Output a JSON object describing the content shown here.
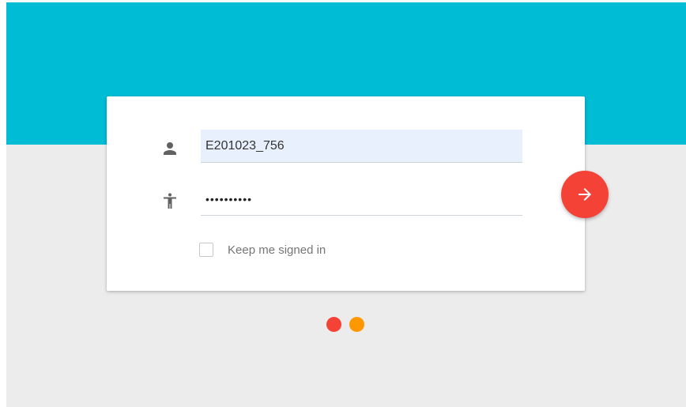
{
  "colors": {
    "accent": "#00bcd4",
    "background": "#ececec",
    "card": "#ffffff",
    "fab": "#f44336",
    "autofill": "#e8f0fe"
  },
  "login": {
    "username": {
      "icon": "person-icon",
      "value": "E201023_756"
    },
    "password": {
      "icon": "accessibility-icon",
      "value": "••••••••••"
    },
    "remember": {
      "label": "Keep me signed in",
      "checked": false
    },
    "submit": {
      "icon": "arrow-right-icon"
    }
  },
  "loader": {
    "dots": [
      {
        "color": "#f44336"
      },
      {
        "color": "#ff9800"
      }
    ]
  }
}
